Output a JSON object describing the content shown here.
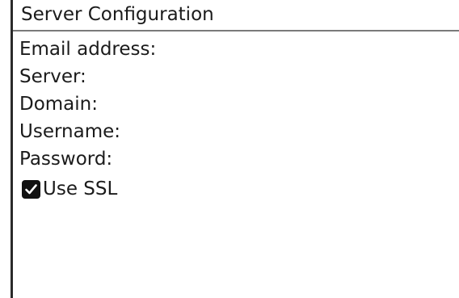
{
  "header": {
    "title": "Server Configuration"
  },
  "form": {
    "email_label": "Email address:",
    "server_label": "Server:",
    "domain_label": "Domain:",
    "username_label": "Username:",
    "password_label": "Password:",
    "ssl_label": "Use SSL",
    "ssl_checked": true
  },
  "icons": {
    "checkbox": "checkmark-icon"
  }
}
